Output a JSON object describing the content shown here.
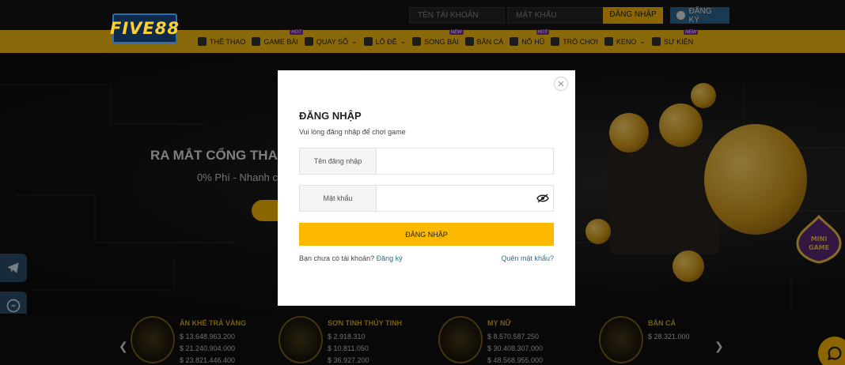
{
  "top": {
    "logo_text": "FIVE88",
    "username_placeholder": "TÊN TÀI KHOẢN",
    "password_placeholder": "MẬT KHẨU",
    "login_label": "ĐĂNG NHẬP",
    "signup_label": "ĐĂNG KÝ"
  },
  "nav": {
    "items": [
      {
        "label": "THỂ THAO",
        "icon": "running-icon",
        "badge": ""
      },
      {
        "label": "GAME BÀI",
        "icon": "cards-icon",
        "badge": "HOT"
      },
      {
        "label": "QUAY SỐ",
        "icon": "dice-icon",
        "badge": "",
        "dropdown": true
      },
      {
        "label": "LÔ ĐỀ",
        "icon": "lottery-icon",
        "badge": "",
        "dropdown": true
      },
      {
        "label": "SONG BÀI",
        "icon": "casino-icon",
        "badge": "NEW"
      },
      {
        "label": "BẮN CÁ",
        "icon": "fish-icon",
        "badge": ""
      },
      {
        "label": "NỔ HŨ",
        "icon": "slot-icon",
        "badge": "HOT"
      },
      {
        "label": "TRÒ CHƠI",
        "icon": "gamepad-icon",
        "badge": ""
      },
      {
        "label": "KENO",
        "icon": "keno-icon",
        "badge": "",
        "dropdown": true
      },
      {
        "label": "SỰ KIỆN",
        "icon": "flag-icon",
        "badge": "NEW"
      }
    ]
  },
  "hero": {
    "title": "RA MẮT CỔNG THAN",
    "subtitle": "0% Phí - Nhanh c",
    "button_label": "N"
  },
  "modal": {
    "title": "ĐĂNG NHẬP",
    "subtitle": "Vui lòng đăng nhập để chơi game",
    "username_label": "Tên đăng nhập",
    "username_value": "",
    "password_label": "Mật khẩu",
    "password_value": "",
    "submit_label": "ĐĂNG NHẬP",
    "no_account_text": "Bạn chưa có tài khoản?",
    "register_link": "Đăng ký",
    "forgot_link": "Quên mật khẩu?"
  },
  "jackpots": [
    {
      "name": "ĂN KHẾ TRẢ VÀNG",
      "values": [
        "$ 13.648.963.200",
        "$ 21.240.904.000",
        "$ 23.821.446.400"
      ]
    },
    {
      "name": "SƠN TINH THỦY TINH",
      "values": [
        "$ 2.918.310",
        "$ 10.811.050",
        "$ 36.927.200"
      ]
    },
    {
      "name": "MỴ NỮ",
      "values": [
        "$ 8.570.587.250",
        "$ 30.408.307.000",
        "$ 48.568.955.000"
      ]
    },
    {
      "name": "BẮN CÁ",
      "values": [
        "$ 28.321.000",
        "",
        ""
      ]
    }
  ],
  "minigame_label": "MINI GAME",
  "colors": {
    "accent": "#fcb900",
    "link": "#2b6f8e",
    "nav_bg": "#fbbf14"
  }
}
